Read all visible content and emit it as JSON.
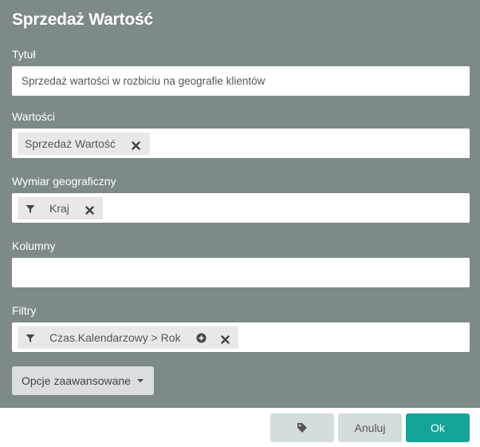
{
  "dialog": {
    "title": "Sprzedaż Wartość"
  },
  "fields": {
    "title_label": "Tytuł",
    "title_value": "Sprzedaż wartości w rozbiciu na geografie klientów",
    "values_label": "Wartości",
    "values_chip": "Sprzedaż Wartość",
    "geo_label": "Wymiar geograficzny",
    "geo_chip": "Kraj",
    "columns_label": "Kolumny",
    "filters_label": "Filtry",
    "filters_chip": "Czas.Kalendarzowy > Rok"
  },
  "advanced": {
    "label": "Opcje zaawansowane"
  },
  "footer": {
    "tag_icon": "tag-icon",
    "cancel_label": "Anuluj",
    "ok_label": "Ok"
  },
  "colors": {
    "dialog_bg": "#7e8a8a",
    "primary": "#12a597",
    "secondary_button": "#d5dce0"
  }
}
